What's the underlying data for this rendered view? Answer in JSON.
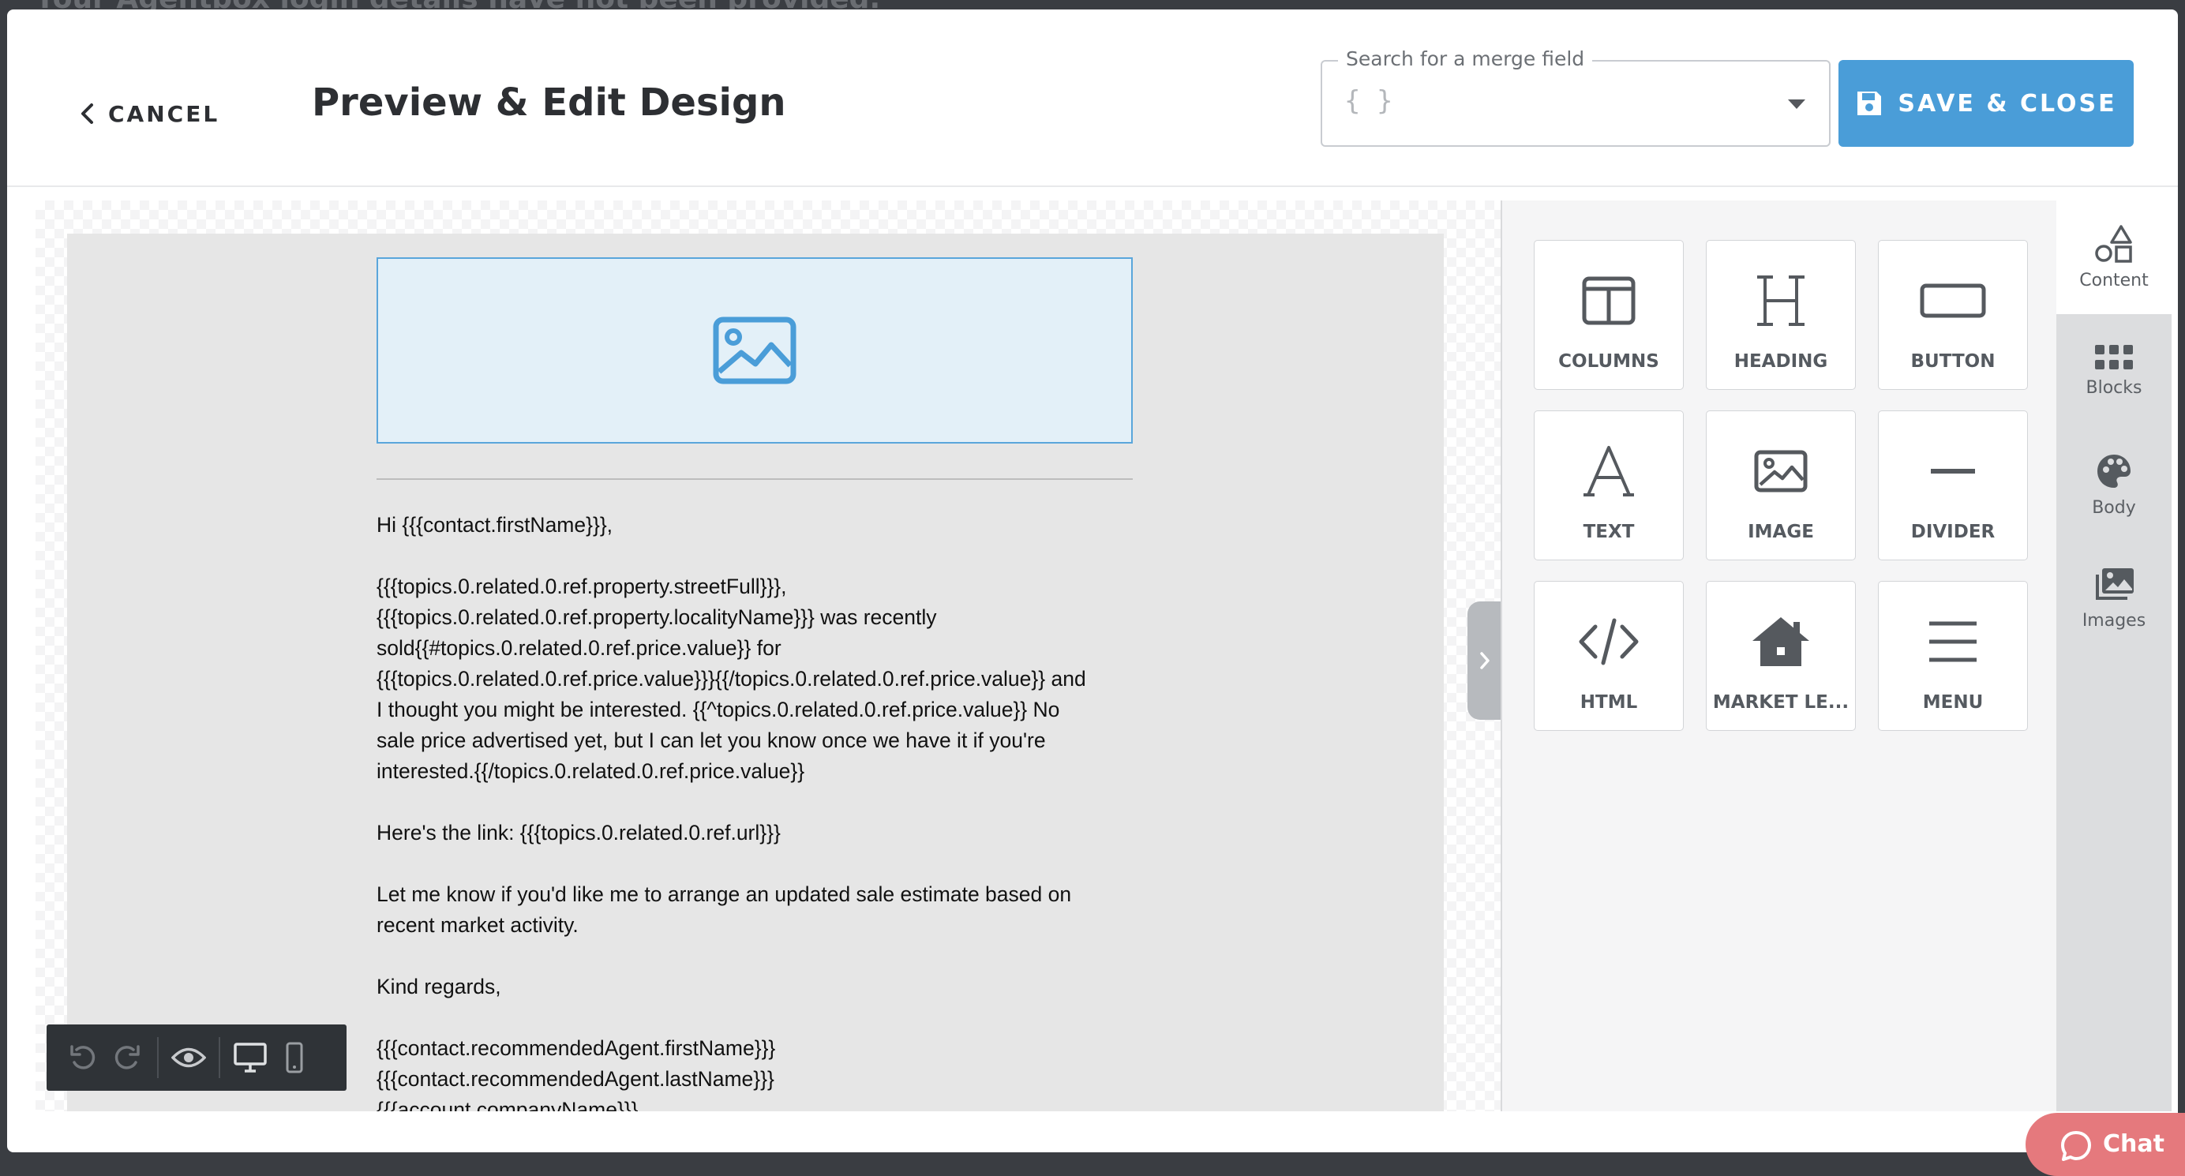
{
  "backdrop": {
    "notice": "Your Agentbox login details have not been provided."
  },
  "header": {
    "cancel_label": "CANCEL",
    "title": "Preview & Edit Design",
    "merge_search": {
      "legend": "Search for a merge field",
      "value": "{ }"
    },
    "save_label": "SAVE & CLOSE"
  },
  "colors": {
    "accent": "#4a9dd8",
    "chat": "#e5797d",
    "toolbar": "#2f3337"
  },
  "email": {
    "greeting": "Hi {{{contact.firstName}}},",
    "body_lines": [
      "{{{topics.0.related.0.ref.property.streetFull}}},",
      "{{{topics.0.related.0.ref.property.localityName}}} was recently",
      "sold{{#topics.0.related.0.ref.price.value}} for",
      "{{{topics.0.related.0.ref.price.value}}}{{/topics.0.related.0.ref.price.value}} and",
      "I thought you might be interested. {{^topics.0.related.0.ref.price.value}} No",
      "sale price advertised yet, but I can let you know once we have it if you're",
      "interested.{{/topics.0.related.0.ref.price.value}}"
    ],
    "link_line": "Here's the link: {{{topics.0.related.0.ref.url}}}",
    "estimate_lines": [
      "Let me know if you'd like me to arrange an updated sale estimate based on",
      "recent market activity."
    ],
    "signoff": "Kind regards,",
    "signature_lines": [
      "{{{contact.recommendedAgent.firstName}}}",
      "{{{contact.recommendedAgent.lastName}}}",
      "{{{account.companyName}}}"
    ]
  },
  "toolbar": {
    "icons": [
      "undo-icon",
      "redo-icon",
      "eye-icon",
      "desktop-icon",
      "mobile-icon"
    ]
  },
  "content_tools": [
    {
      "label": "COLUMNS",
      "icon": "columns-icon"
    },
    {
      "label": "HEADING",
      "icon": "heading-icon"
    },
    {
      "label": "BUTTON",
      "icon": "button-icon"
    },
    {
      "label": "TEXT",
      "icon": "text-icon"
    },
    {
      "label": "IMAGE",
      "icon": "image-icon"
    },
    {
      "label": "DIVIDER",
      "icon": "divider-icon"
    },
    {
      "label": "HTML",
      "icon": "code-icon"
    },
    {
      "label": "MARKET LE...",
      "icon": "house-icon"
    },
    {
      "label": "MENU",
      "icon": "menu-icon"
    }
  ],
  "side_tabs": [
    {
      "label": "Content",
      "icon": "shapes-icon",
      "active": true
    },
    {
      "label": "Blocks",
      "icon": "grid-icon",
      "active": false
    },
    {
      "label": "Body",
      "icon": "palette-icon",
      "active": false
    },
    {
      "label": "Images",
      "icon": "images-icon",
      "active": false
    }
  ],
  "chat": {
    "label": "Chat"
  }
}
